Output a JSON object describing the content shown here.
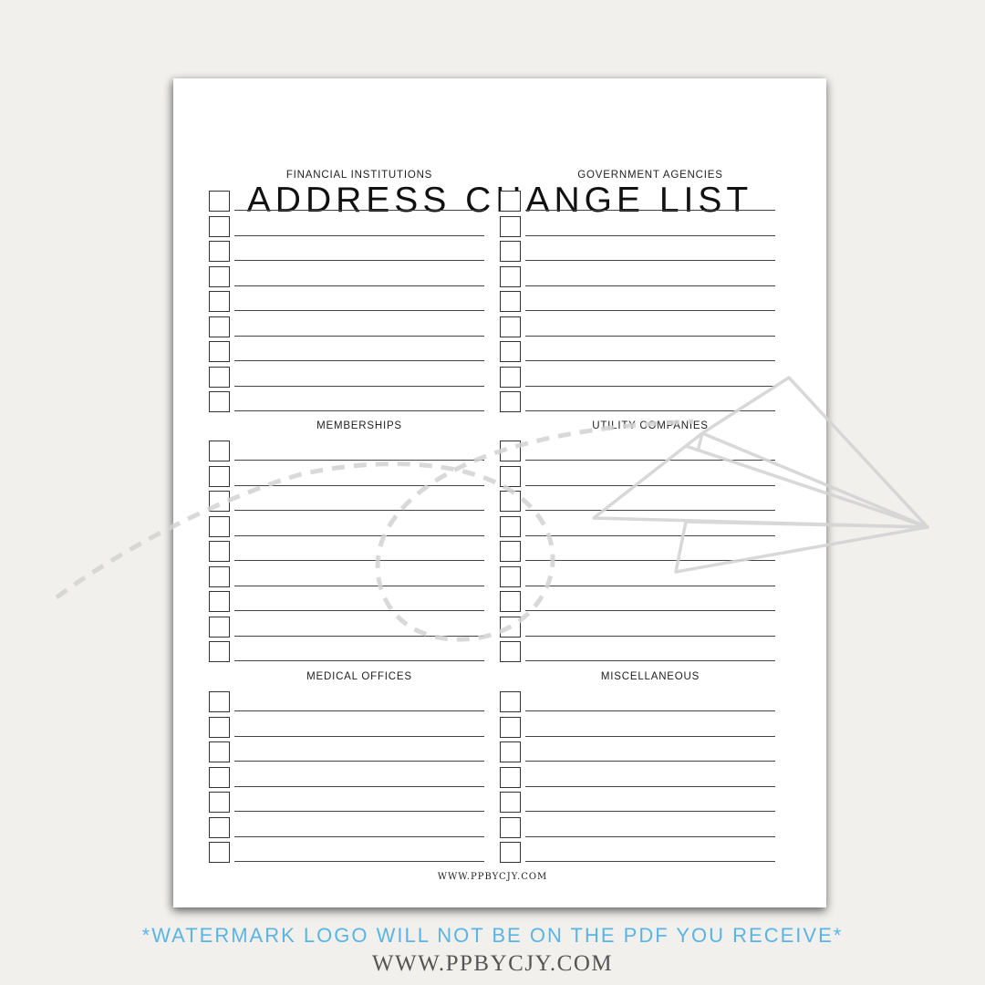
{
  "document": {
    "title": "ADDRESS CHANGE LIST",
    "footer_url": "WWW.PPBYCJY.COM",
    "sections": [
      {
        "heading": "FINANCIAL INSTITUTIONS",
        "column": "left",
        "rows": 9
      },
      {
        "heading": "GOVERNMENT AGENCIES",
        "column": "right",
        "rows": 9
      },
      {
        "heading": "MEMBERSHIPS",
        "column": "left",
        "rows": 9
      },
      {
        "heading": "UTILITY COMPANIES",
        "column": "right",
        "rows": 9
      },
      {
        "heading": "MEDICAL OFFICES",
        "column": "left",
        "rows": 7
      },
      {
        "heading": "MISCELLANEOUS",
        "column": "right",
        "rows": 7
      }
    ]
  },
  "watermark": {
    "icon": "paper-airplane-icon",
    "disclaimer": "*WATERMARK LOGO WILL NOT BE ON THE PDF YOU RECEIVE*",
    "site": "WWW.PPBYCJY.COM"
  },
  "colors": {
    "background": "#f1f0ec",
    "paper": "#ffffff",
    "disclaimer": "#5ab4e5",
    "watermark": "#d6d6d6"
  }
}
